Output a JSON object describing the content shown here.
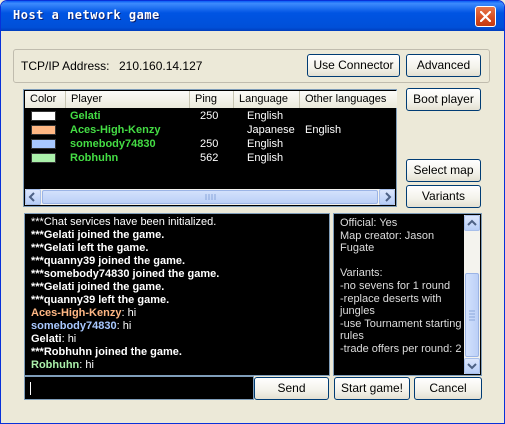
{
  "window": {
    "title": "Host a network game"
  },
  "connection": {
    "label": "TCP/IP Address:",
    "address": "210.160.14.127",
    "use_connector_label": "Use Connector",
    "advanced_label": "Advanced"
  },
  "players_table": {
    "columns": [
      "Color",
      "Player",
      "Ping",
      "Language",
      "Other languages"
    ],
    "rows": [
      {
        "color": "#ffffff",
        "player": "Gelati",
        "ping": "250",
        "language": "English",
        "other": ""
      },
      {
        "color": "#ffb784",
        "player": "Aces-High-Kenzy",
        "ping": "",
        "language": "Japanese",
        "other": "English"
      },
      {
        "color": "#a8c8ff",
        "player": "somebody74830",
        "ping": "250",
        "language": "English",
        "other": ""
      },
      {
        "color": "#aaf0aa",
        "player": "Robhuhn",
        "ping": "562",
        "language": "English",
        "other": ""
      }
    ]
  },
  "side_buttons": {
    "boot_player": "Boot player",
    "select_map": "Select map",
    "variants": "Variants"
  },
  "chat": {
    "lines": [
      {
        "text": "***Chat services have been initialized.",
        "style": "plain"
      },
      {
        "text": "***Gelati joined the game.",
        "style": "sys"
      },
      {
        "text": "***Gelati left the game.",
        "style": "sys"
      },
      {
        "text": "***quanny39 joined the game.",
        "style": "sys"
      },
      {
        "text": "***somebody74830 joined the game.",
        "style": "sys"
      },
      {
        "text": "***Gelati joined the game.",
        "style": "sys"
      },
      {
        "text": "***quanny39 left the game.",
        "style": "sys"
      },
      {
        "name": "Aces-High-Kenzy",
        "msg": ": hi",
        "name_color": "#ffb784"
      },
      {
        "name": "somebody74830",
        "msg": ": hi",
        "name_color": "#a8c8ff"
      },
      {
        "name": "Gelati",
        "msg": ": hi",
        "name_color": "#ffffff"
      },
      {
        "text": "***Robhuhn joined the game.",
        "style": "sys"
      },
      {
        "name": "Robhuhn",
        "msg": ": hi",
        "name_color": "#aaf0aa"
      }
    ],
    "input_value": "",
    "send_label": "Send"
  },
  "game_info": {
    "lines": [
      "Official: Yes",
      "Map creator: Jason",
      "Fugate",
      "",
      "Variants:",
      "-no sevens for 1 round",
      "-replace deserts with",
      "jungles",
      "-use Tournament starting",
      "rules",
      "-trade offers per round: 2"
    ]
  },
  "footer": {
    "start_label": "Start game!",
    "cancel_label": "Cancel"
  }
}
